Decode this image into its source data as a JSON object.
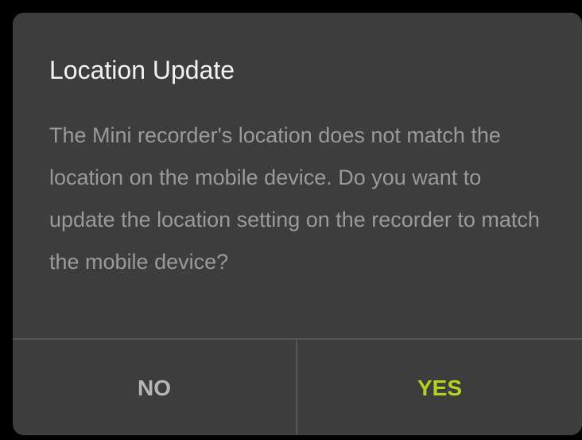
{
  "dialog": {
    "title": "Location Update",
    "message": "The Mini recorder's location does not match the location on the mobile device. Do you want to update the location setting on the recorder to match the mobile device?",
    "buttons": {
      "no_label": "NO",
      "yes_label": "YES"
    }
  },
  "colors": {
    "backdrop": "#000000",
    "dialog_background": "#3d3d3d",
    "title_text": "#f2f2f2",
    "message_text": "#9a9a9a",
    "divider": "#555555",
    "no_button_text": "#b5b5b5",
    "yes_button_accent": "#b3d41c"
  }
}
